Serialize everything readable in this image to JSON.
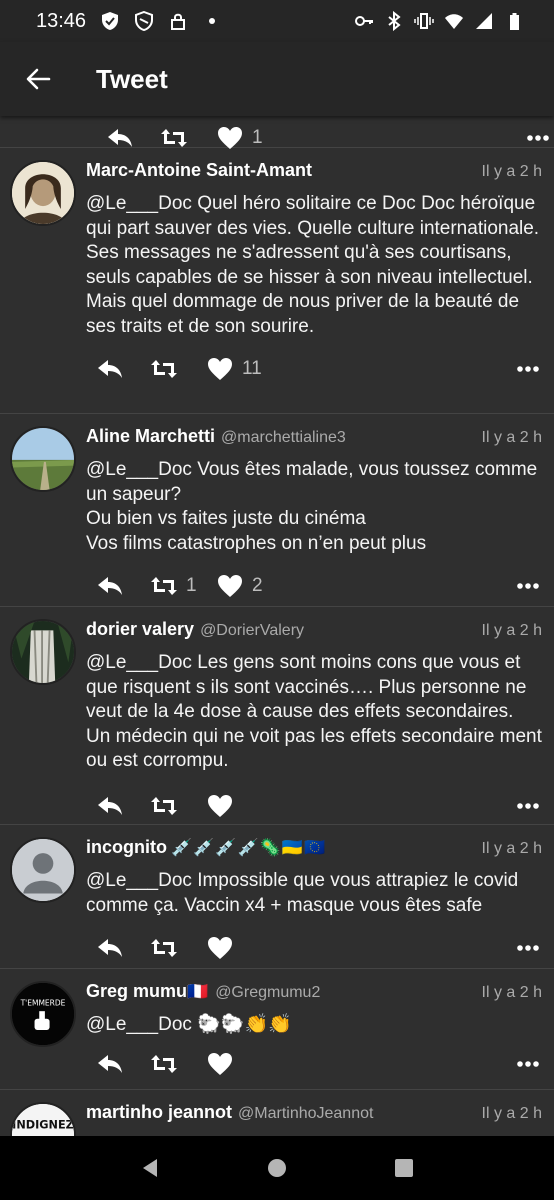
{
  "status_bar": {
    "time": "13:46",
    "left_icons": [
      "shield-check-icon",
      "shield-icon",
      "lock-icon",
      "dot-icon"
    ],
    "right_icons": [
      "key-icon",
      "bluetooth-icon",
      "vibrate-icon",
      "wifi-icon",
      "signal-icon",
      "battery-icon"
    ]
  },
  "app_bar": {
    "title": "Tweet"
  },
  "partial_tweet": {
    "like_count": "1"
  },
  "tweets": [
    {
      "name": "Marc-Antoine Saint-Amant",
      "handle": "",
      "time": "Il y a 2 h",
      "text": "@Le___Doc Quel héro solitaire ce Doc Doc héroïque qui part sauver des vies. Quelle culture internationale. Ses messages ne s'adressent qu'à ses courtisans, seuls capables de se hisser à son niveau intellectuel.\nMais quel dommage de nous priver de la beauté de ses traits et de son sourire.",
      "retweets": "",
      "likes": "11"
    },
    {
      "name": "Aline Marchetti",
      "handle": "@marchettialine3",
      "time": "Il y a 2 h",
      "text": "@Le___Doc Vous êtes malade, vous toussez comme un sapeur?\nOu bien vs faites juste du cinéma\nVos films catastrophes on n’en peut plus",
      "retweets": "1",
      "likes": "2"
    },
    {
      "name": "dorier valery",
      "handle": "@DorierValery",
      "time": "Il y a 2 h",
      "text": "@Le___Doc Les gens sont moins cons que vous et que risquent s ils sont vaccinés…. Plus personne ne veut de la 4e dose à cause des effets secondaires. Un médecin qui ne voit pas les effets secondaire ment ou est corrompu.",
      "retweets": "",
      "likes": ""
    },
    {
      "name": "incognito",
      "name_emoji": "💉💉💉💉🦠🇺🇦🇪🇺",
      "handle": "",
      "time": "Il y a 2 h",
      "text": "@Le___Doc Impossible que vous attrapiez le covid comme ça. Vaccin x4 + masque vous êtes safe",
      "retweets": "",
      "likes": ""
    },
    {
      "name": "Greg mumu",
      "name_emoji": "🇫🇷",
      "handle": "@Gregmumu2",
      "time": "Il y a 2 h",
      "text": "@Le___Doc 🐑🐑👏👏",
      "retweets": "",
      "likes": ""
    },
    {
      "name": "martinho jeannot",
      "handle": "@MartinhoJeannot",
      "time": "Il y a 2 h",
      "text": "",
      "retweets": "",
      "likes": ""
    }
  ],
  "avatars": {
    "greg_logo_text": "T'EMMERDE",
    "martinho_logo_text": "INDIGNEZ"
  },
  "colors": {
    "background": "#2f2f2f",
    "bars": "#262626",
    "divider": "#444444",
    "secondary_text": "#aaaaaa"
  }
}
